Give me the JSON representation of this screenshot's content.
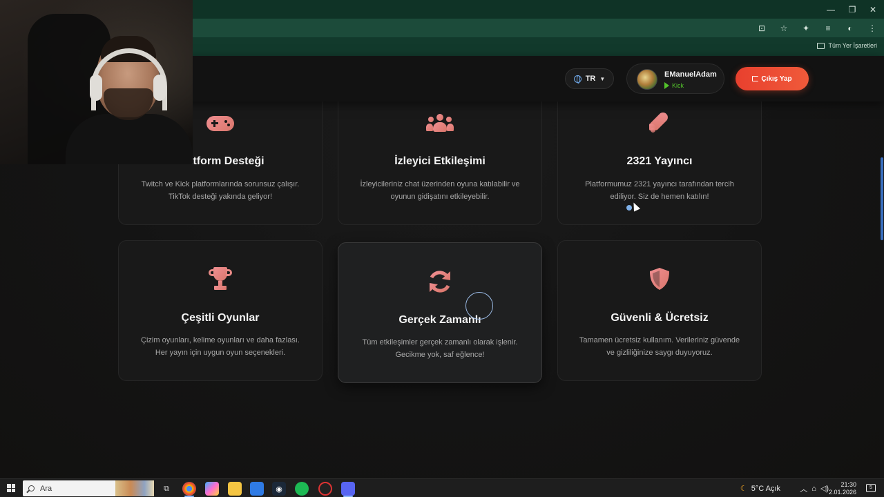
{
  "browser": {
    "bookmarks_all_label": "Tüm Yer İşaretleri",
    "window_controls": [
      "—",
      "❐",
      "✕"
    ]
  },
  "header": {
    "language_code": "TR",
    "user": {
      "name": "EManuelAdam",
      "platform": "Kick"
    },
    "logout_label": "Çıkış Yap"
  },
  "features": [
    {
      "icon": "gamepad-icon",
      "title": "Platform Desteği",
      "text": "Twitch ve Kick platformlarında sorunsuz çalışır. TikTok desteği yakında geliyor!"
    },
    {
      "icon": "users-icon",
      "title": "İzleyici Etkileşimi",
      "text": "İzleyicileriniz chat üzerinden oyuna katılabilir ve oyunun gidişatını etkileyebilir."
    },
    {
      "icon": "rocket-icon",
      "title": "2321 Yayıncı",
      "text": "Platformumuz 2321 yayıncı tarafından tercih ediliyor. Siz de hemen katılın!"
    },
    {
      "icon": "trophy-icon",
      "title": "Çeşitli Oyunlar",
      "text": "Çizim oyunları, kelime oyunları ve daha fazlası. Her yayın için uygun oyun seçenekleri."
    },
    {
      "icon": "sync-icon",
      "title": "Gerçek Zamanlı",
      "text": "Tüm etkileşimler gerçek zamanlı olarak işlenir. Gecikme yok, saf eğlence!"
    },
    {
      "icon": "shield-icon",
      "title": "Güvenli & Ücretsiz",
      "text": "Tamamen ücretsiz kullanım. Verileriniz güvende ve gizliliğinize saygı duyuyoruz."
    }
  ],
  "taskbar": {
    "search_placeholder": "Ara",
    "weather": "5°C  Açık",
    "time": "21:30",
    "date": "2.01.2026",
    "notification_count": "5"
  },
  "colors": {
    "accent_icon": "#e88a86",
    "logout_bg": "#ee4d34",
    "kick_green": "#53c22b",
    "browser_chrome": "#123a2c"
  }
}
